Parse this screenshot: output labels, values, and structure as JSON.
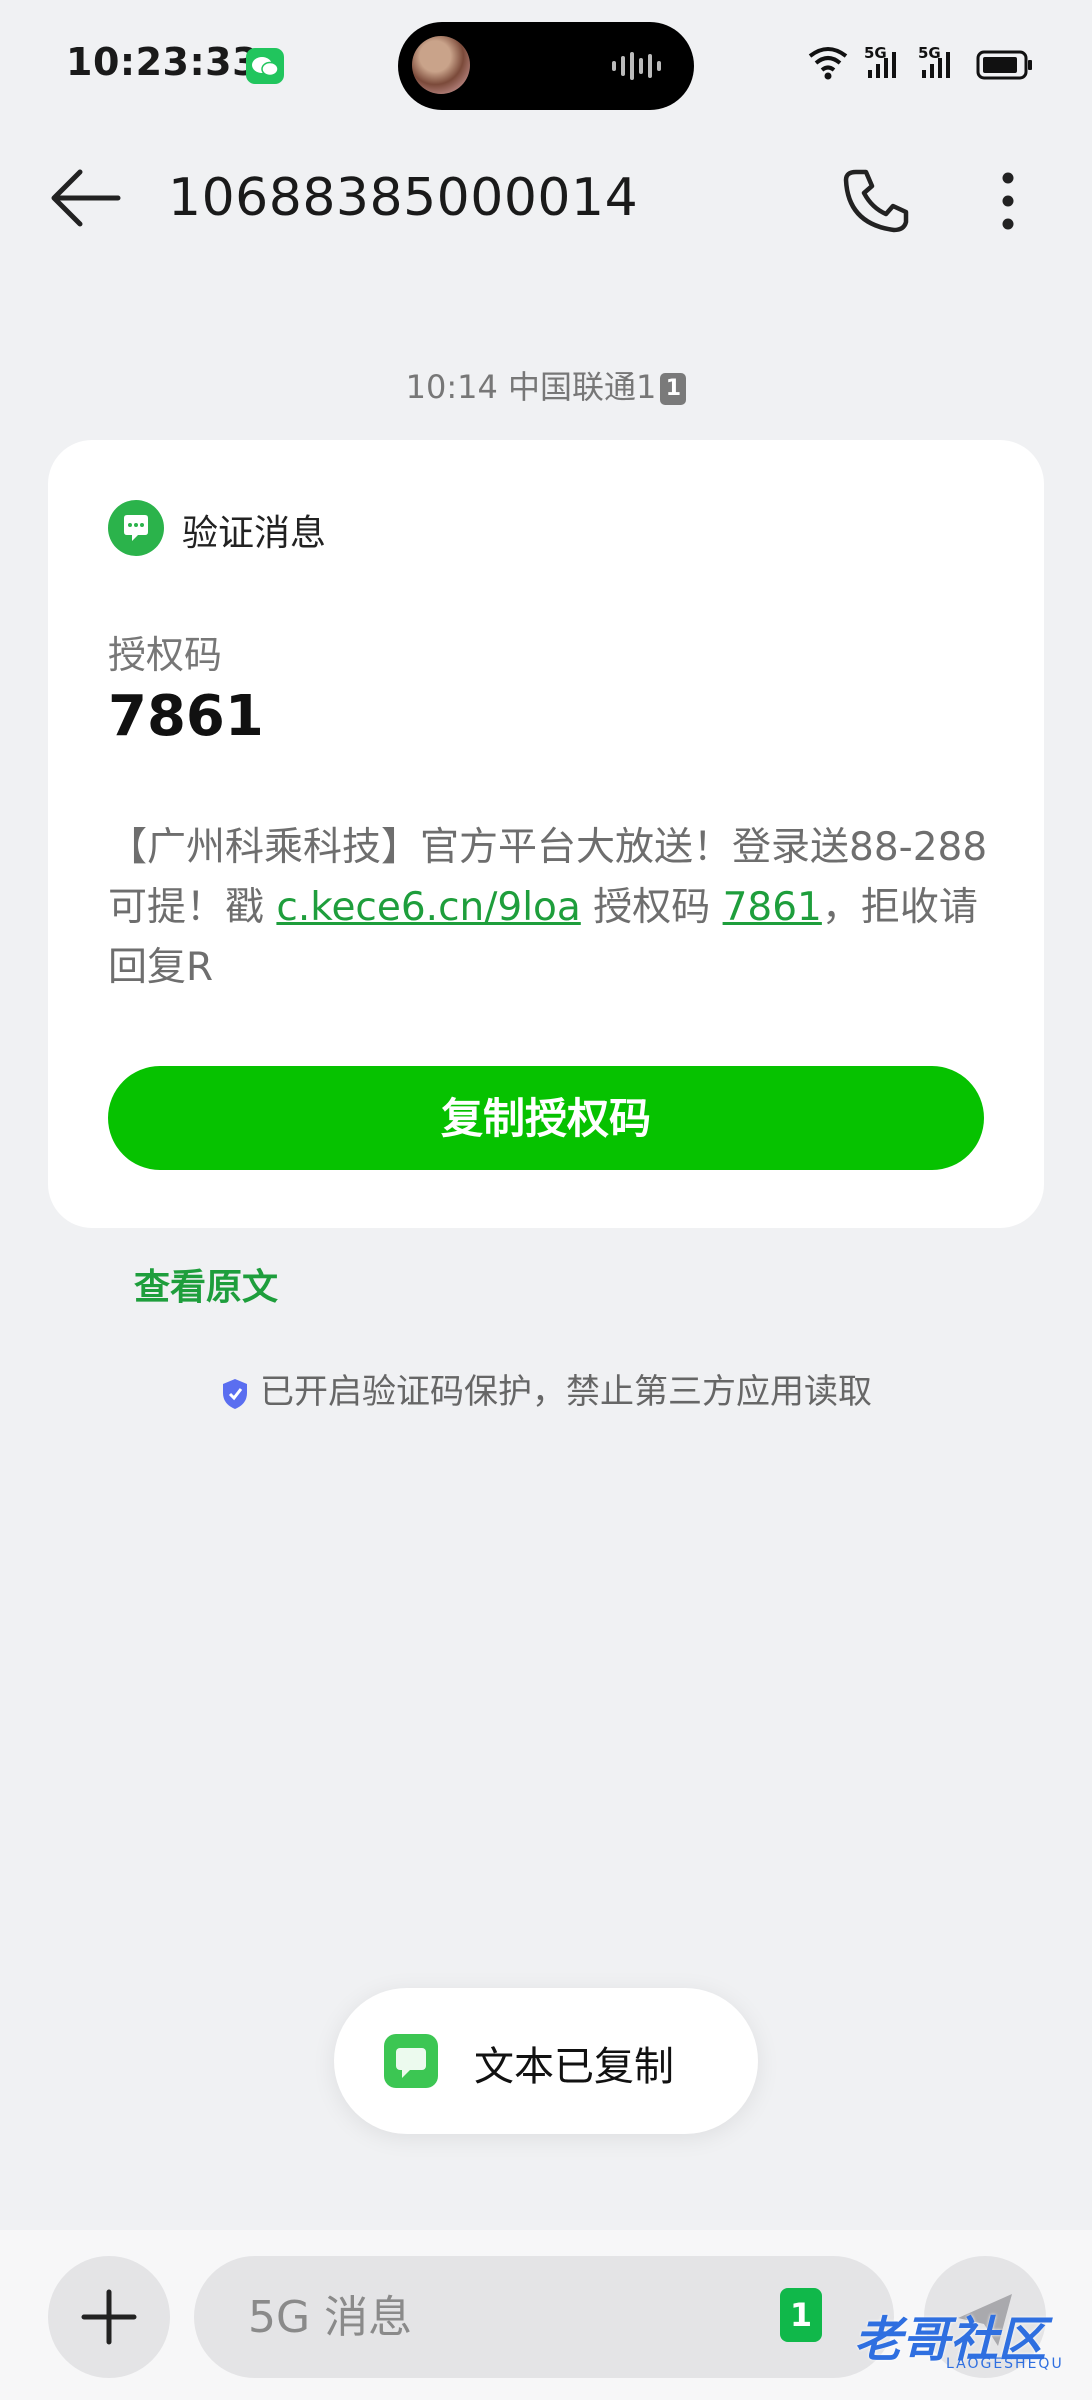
{
  "status_bar": {
    "time": "10:23:33",
    "network_1": "5G",
    "network_2": "5G"
  },
  "header": {
    "title": "10688385000014"
  },
  "thread": {
    "timestamp": "10:14",
    "carrier": "中国联通1",
    "sim_slot": "1"
  },
  "card": {
    "badge_label": "验证消息",
    "code_label": "授权码",
    "code_value": "7861",
    "body_prefix": "【广州科乘科技】官方平台大放送！登录送88-288可提！戳 ",
    "body_link": "c.kece6.cn/9loa",
    "body_middle": " 授权码 ",
    "body_code_link": "7861",
    "body_suffix": "，拒收请回复R",
    "copy_button": "复制授权码"
  },
  "view_original": "查看原文",
  "protection_notice": "已开启验证码保护，禁止第三方应用读取",
  "toast": {
    "text": "文本已复制"
  },
  "composer": {
    "placeholder": "5G 消息",
    "sim_slot": "1"
  },
  "watermark": {
    "text": "老哥社区",
    "sub": "LAOGESHEQU"
  },
  "colors": {
    "accent_green": "#06c200",
    "link_green": "#1e9e3c",
    "background": "#f0f1f3"
  }
}
